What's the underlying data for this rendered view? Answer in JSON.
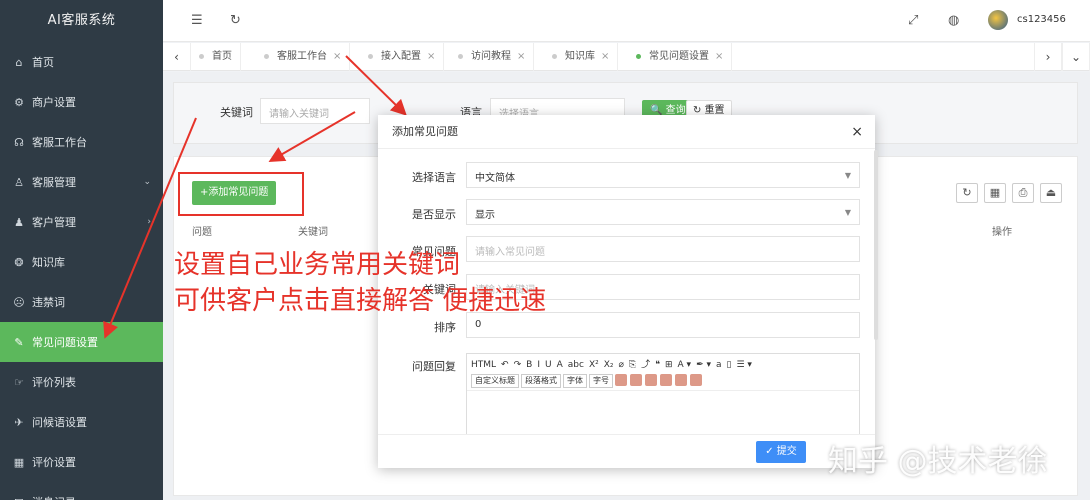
{
  "app": {
    "brand": "AI客服系统"
  },
  "sidebar": {
    "items": [
      {
        "label": "首页",
        "icon": "home-icon",
        "glyph": "⌂"
      },
      {
        "label": "商户设置",
        "icon": "gear-icon",
        "glyph": "⚙"
      },
      {
        "label": "客服工作台",
        "icon": "headset-icon",
        "glyph": "☊"
      },
      {
        "label": "客服管理",
        "icon": "user-icon",
        "glyph": "♙",
        "chev": "⌄"
      },
      {
        "label": "客户管理",
        "icon": "users-icon",
        "glyph": "♟",
        "chev": "›"
      },
      {
        "label": "知识库",
        "icon": "book-icon",
        "glyph": "❂"
      },
      {
        "label": "违禁词",
        "icon": "block-icon",
        "glyph": "☹"
      },
      {
        "label": "常见问题设置",
        "icon": "edit-icon",
        "glyph": "✎",
        "active": true
      },
      {
        "label": "评价列表",
        "icon": "thumb-icon",
        "glyph": "☞"
      },
      {
        "label": "问候语设置",
        "icon": "send-icon",
        "glyph": "✈"
      },
      {
        "label": "评价设置",
        "icon": "calendar-icon",
        "glyph": "▦"
      },
      {
        "label": "消息记录",
        "icon": "message-icon",
        "glyph": "✉"
      }
    ]
  },
  "topbar": {
    "menu_glyph": "☰",
    "refresh_glyph": "↻",
    "fullscreen_glyph": "⤢",
    "globe_glyph": "◍",
    "username": "cs123456"
  },
  "tabs": {
    "prev": "‹",
    "next": "›",
    "more": "⌄",
    "close": "×",
    "items": [
      "首页",
      "客服工作台",
      "接入配置",
      "访问教程",
      "知识库",
      "常见问题设置"
    ]
  },
  "search": {
    "keyword_label": "关键词",
    "keyword_placeholder": "请输入关键词",
    "language_label": "语言",
    "language_placeholder": "选择语言",
    "query_button": "🔍 查询",
    "reset_button": "↻ 重置"
  },
  "table": {
    "add_button": "+添加常见问题",
    "col_question": "问题",
    "col_keyword": "关键词",
    "col_action": "操作",
    "tool_refresh": "↻",
    "tool_grid": "▦",
    "tool_print": "⎙",
    "tool_export": "⏏"
  },
  "annotation": {
    "line1": "设置自己业务常用关键词",
    "line2": "可供客户点击直接解答  便捷迅速",
    "color": "#e6332a"
  },
  "modal": {
    "title": "添加常见问题",
    "close": "×",
    "fields": {
      "language_label": "选择语言",
      "language_value": "中文简体",
      "display_label": "是否显示",
      "display_value": "显示",
      "question_label": "常见问题",
      "question_placeholder": "请输入常见问题",
      "keyword_label": "关键词",
      "keyword_placeholder": "请输入关键词",
      "sort_label": "排序",
      "sort_value": "0",
      "reply_label": "问题回复"
    },
    "editor": {
      "row1_glyphs": [
        "HTML",
        "↶",
        "↷",
        "B",
        "I",
        "U",
        "A",
        "abc",
        "X²",
        "X₂",
        "⌀",
        "⎘",
        "⤴",
        "❝",
        "⊞",
        "A ▾",
        "✒ ▾",
        "a",
        "▯",
        "☰ ▾"
      ],
      "selects": [
        "自定义标题",
        "段落格式",
        "字体",
        "字号"
      ]
    },
    "submit": "✓ 提交"
  },
  "watermark": "知乎 @技术老徐"
}
